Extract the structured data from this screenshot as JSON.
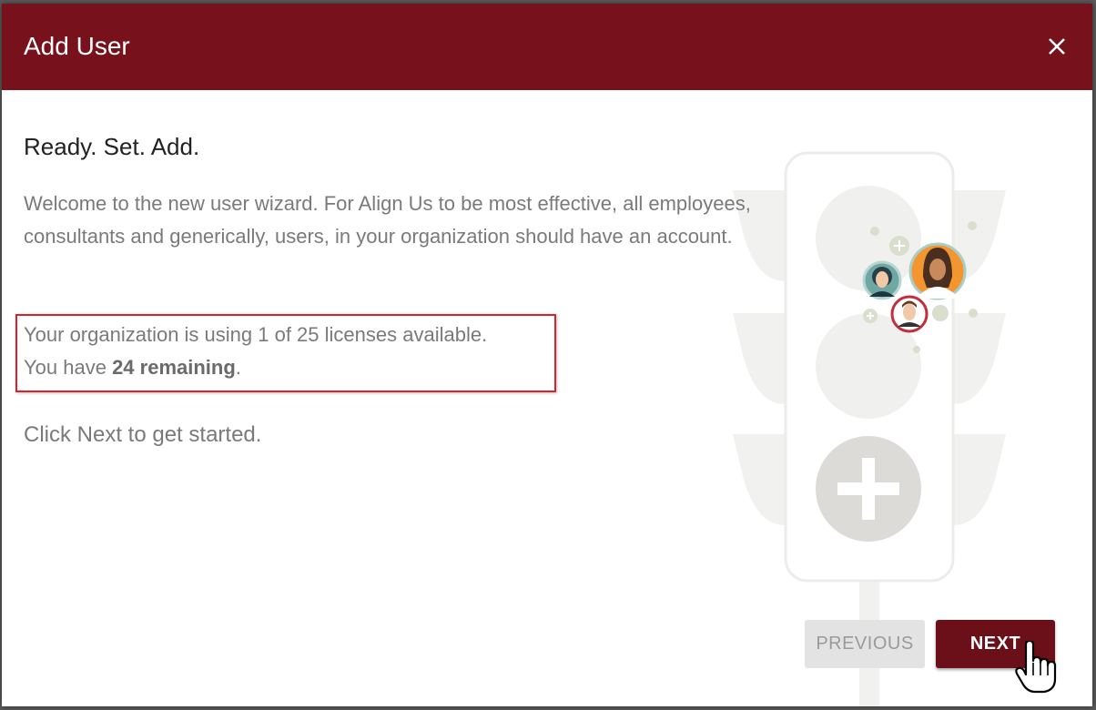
{
  "dialog": {
    "title": "Add User",
    "close_icon": "close-icon"
  },
  "content": {
    "heading": "Ready. Set. Add.",
    "intro": "Welcome to the new user wizard. For Align Us to be most effective, all employees, consultants and generically, users, in your organization should have an account.",
    "license_line1": "Your organization is using 1 of 25 licenses available.",
    "license_line2_prefix": "You have ",
    "license_line2_bold": "24 remaining",
    "license_line2_suffix": ".",
    "call_to_action": "Click Next to get started."
  },
  "buttons": {
    "previous": "PREVIOUS",
    "next": "NEXT"
  },
  "colors": {
    "header": "#77111c",
    "next_button": "#6b0f19",
    "highlight_border": "#d8232a"
  }
}
